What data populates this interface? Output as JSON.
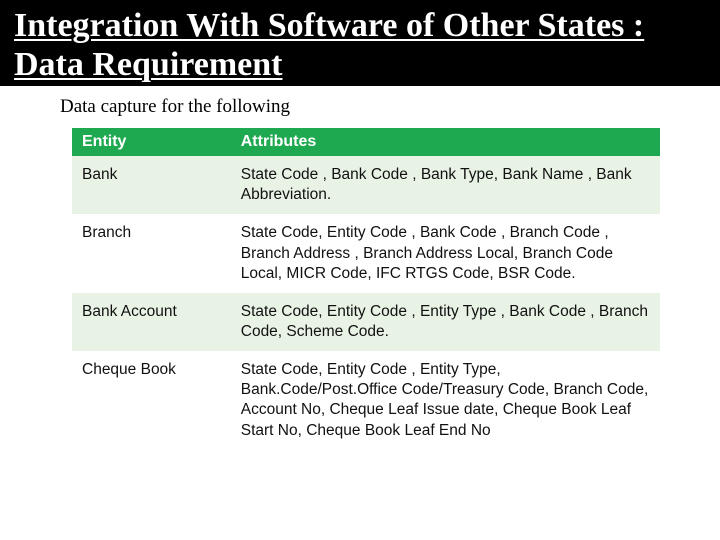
{
  "title": "Integration With Software of Other States : Data Requirement",
  "subtitle": "Data capture for the following",
  "table": {
    "headers": {
      "entity": "Entity",
      "attributes": "Attributes"
    },
    "rows": [
      {
        "entity": "Bank",
        "attributes": "State Code , Bank Code , Bank Type, Bank Name , Bank Abbreviation."
      },
      {
        "entity": "Branch",
        "attributes": "State Code, Entity Code , Bank Code , Branch Code , Branch Address , Branch Address Local, Branch Code Local, MICR Code, IFC RTGS Code, BSR Code."
      },
      {
        "entity": "Bank Account",
        "attributes": "State Code, Entity Code , Entity Type , Bank Code , Branch Code, Scheme Code."
      },
      {
        "entity": "Cheque Book",
        "attributes": "State Code, Entity Code , Entity Type, Bank.Code/Post.Office Code/Treasury Code, Branch Code, Account No, Cheque Leaf Issue date, Cheque Book Leaf Start No, Cheque Book Leaf End No"
      }
    ]
  }
}
